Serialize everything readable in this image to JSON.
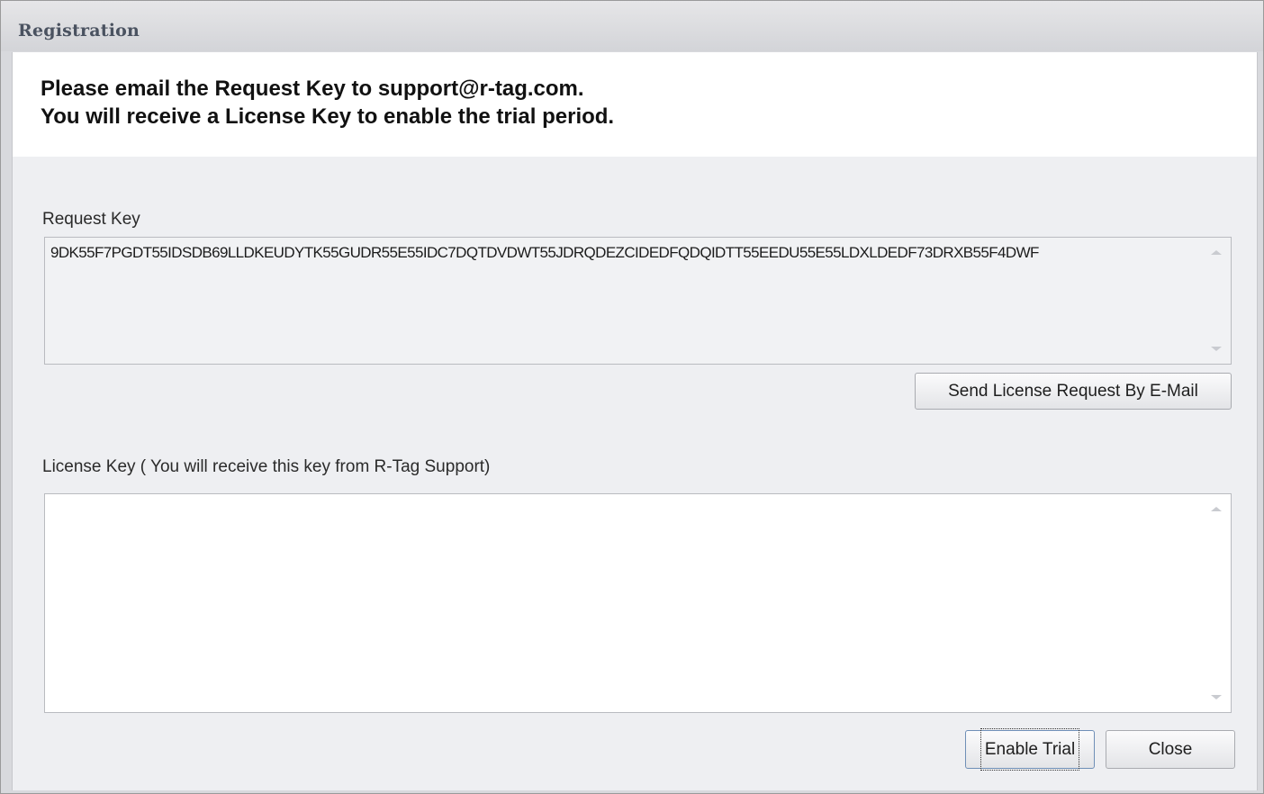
{
  "window": {
    "title": "Registration"
  },
  "header": {
    "line1": "Please email the Request Key to support@r-tag.com.",
    "line2": "You will receive a License Key to enable the trial period."
  },
  "request_key": {
    "label": "Request Key",
    "value": "9DK55F7PGDT55IDSDB69LLDKEUDYTK55GUDR55E55IDC7DQTDVDWT55JDRQDEZCIDEDFQDQIDTT55EEDU55E55LDXLDEDF73DRXB55F4DWF"
  },
  "send_button": {
    "label": "Send License Request By E-Mail"
  },
  "license_key": {
    "label": "License Key ( You will receive this key from R-Tag Support)",
    "value": ""
  },
  "footer": {
    "enable_trial_label": "Enable Trial",
    "close_label": "Close"
  },
  "colors": {
    "client_background": "#eeeff2",
    "header_background": "#ffffff",
    "title_text": "#4a5260"
  }
}
